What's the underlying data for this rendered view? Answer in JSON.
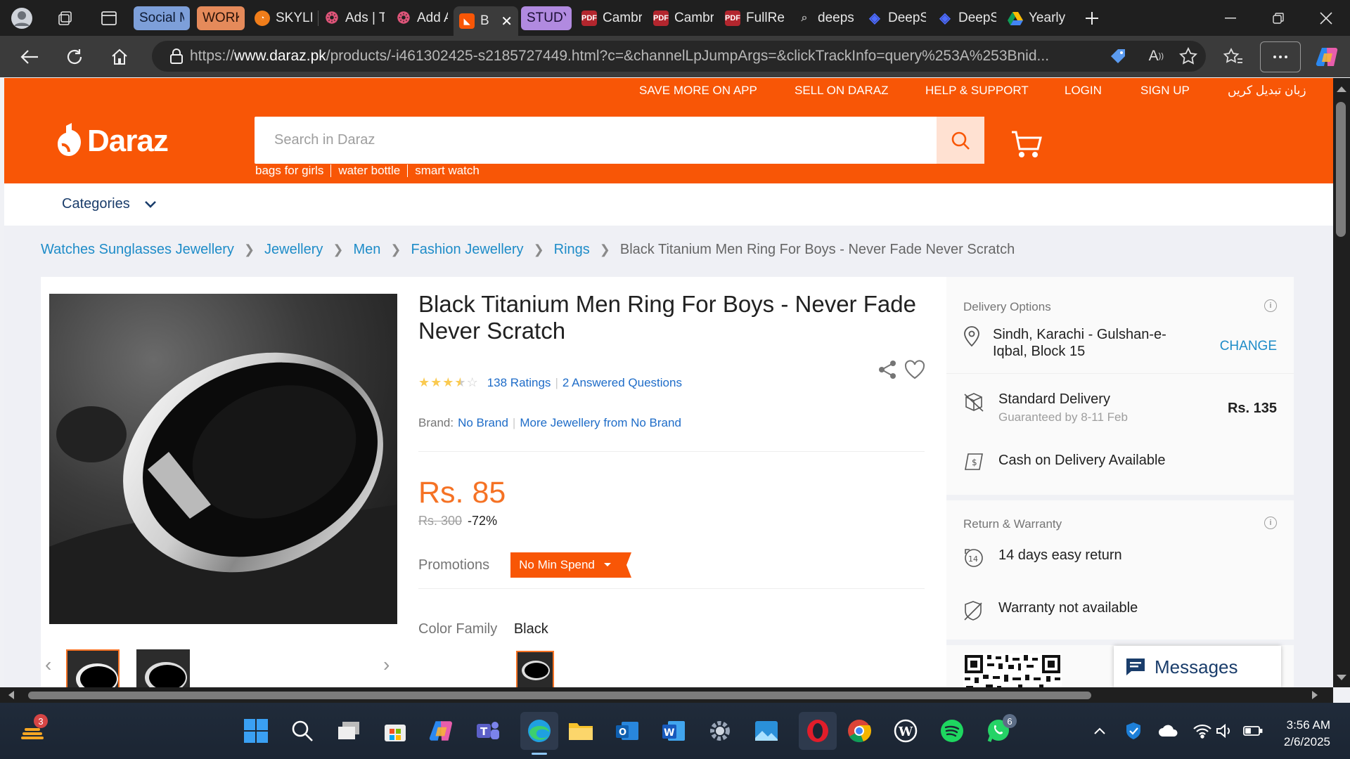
{
  "browser": {
    "tabs": [
      {
        "label": "Social M",
        "group": true,
        "color": "#7d9fd9"
      },
      {
        "label": "WORK",
        "group": true,
        "color": "#e58a5a"
      },
      {
        "label": "SKYLIN",
        "icon": "skyline-favicon"
      },
      {
        "label": "Ads | T",
        "icon": "ads-favicon"
      },
      {
        "label": "Add A",
        "icon": "ads-favicon"
      },
      {
        "label": "B",
        "icon": "daraz-favicon",
        "active": true
      },
      {
        "label": "STUDY",
        "group": true,
        "color": "#b18ae0"
      },
      {
        "label": "Cambr",
        "icon": "pdf-favicon"
      },
      {
        "label": "Cambr",
        "icon": "pdf-favicon"
      },
      {
        "label": "FullRe",
        "icon": "pdf-favicon"
      },
      {
        "label": "deeps",
        "icon": "search-favicon"
      },
      {
        "label": "DeepS",
        "icon": "deepseek-favicon"
      },
      {
        "label": "DeepS",
        "icon": "deepseek-favicon"
      },
      {
        "label": "Yearly",
        "icon": "drive-favicon"
      }
    ],
    "url_prefix": "https://",
    "url_domain": "www.daraz.pk",
    "url_rest": "/products/-i461302425-s2185727449.html?c=&channelLpJumpArgs=&clickTrackInfo=query%253A%253Bnid..."
  },
  "header": {
    "top_links": [
      "SAVE MORE ON APP",
      "SELL ON DARAZ",
      "HELP & SUPPORT",
      "LOGIN",
      "SIGN UP",
      "زبان تبدیل کریں"
    ],
    "logo_text": "Daraz",
    "search_placeholder": "Search in Daraz",
    "suggestions": [
      "bags for girls",
      "water bottle",
      "smart watch"
    ],
    "categories_label": "Categories"
  },
  "breadcrumb": {
    "links": [
      "Watches Sunglasses Jewellery",
      "Jewellery",
      "Men",
      "Fashion Jewellery",
      "Rings"
    ],
    "current": "Black Titanium Men Ring For Boys - Never Fade Never Scratch"
  },
  "product": {
    "title": "Black Titanium Men Ring For Boys - Never Fade Never Scratch",
    "rating_stars": 3.5,
    "ratings_text": "138 Ratings",
    "questions_text": "2 Answered Questions",
    "brand_label": "Brand:",
    "brand_value": "No Brand",
    "brand_more": "More Jewellery from No Brand",
    "price": "Rs. 85",
    "old_price": "Rs. 300",
    "discount": "-72%",
    "promotions_label": "Promotions",
    "promotion_badge": "No Min Spend",
    "color_label": "Color Family",
    "color_value": "Black"
  },
  "delivery": {
    "title": "Delivery Options",
    "location": "Sindh, Karachi - Gulshan-e-Iqbal, Block 15",
    "change_label": "CHANGE",
    "standard_label": "Standard Delivery",
    "standard_eta": "Guaranteed by 8-11 Feb",
    "standard_price": "Rs. 135",
    "cod_label": "Cash on Delivery Available",
    "return_title": "Return & Warranty",
    "return_label": "14 days easy return",
    "warranty_label": "Warranty not available"
  },
  "chat": {
    "label": "Messages"
  },
  "taskbar": {
    "widget_badge": "3",
    "whatsapp_badge": "6",
    "time": "3:56 AM",
    "date": "2/6/2025"
  },
  "colors": {
    "brand_orange": "#f85606",
    "price_orange": "#f57224",
    "link_blue": "#1e6cc8"
  }
}
